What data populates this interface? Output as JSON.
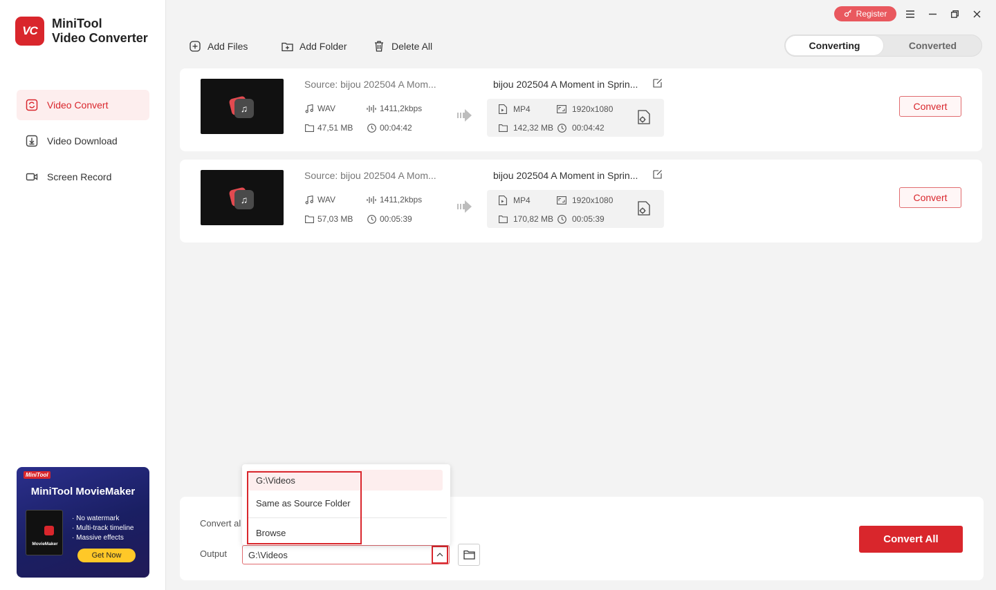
{
  "app": {
    "logo_badge": "VC",
    "name_line1": "MiniTool",
    "name_line2": "Video Converter",
    "accent_color": "#d9262c"
  },
  "sidebar": {
    "items": [
      {
        "label": "Video Convert",
        "icon": "convert-icon",
        "active": true
      },
      {
        "label": "Video Download",
        "icon": "download-icon",
        "active": false
      },
      {
        "label": "Screen Record",
        "icon": "camera-icon",
        "active": false
      }
    ],
    "ad": {
      "brand": "MiniTool",
      "title": "MiniTool MovieMaker",
      "box_label": "MovieMaker",
      "features": [
        "· No watermark",
        "· Multi-track timeline",
        "· Massive effects"
      ],
      "button": "Get Now"
    }
  },
  "titlebar": {
    "register": "Register"
  },
  "toolbar": {
    "add_files": "Add Files",
    "add_folder": "Add Folder",
    "delete_all": "Delete All"
  },
  "tabs": {
    "converting": "Converting",
    "converted": "Converted"
  },
  "files": [
    {
      "source_title": "Source:  bijou 202504 A Mom...",
      "source_format": "WAV",
      "source_bitrate": "1411,2kbps",
      "source_size": "47,51 MB",
      "source_duration": "00:04:42",
      "output_title": "bijou 202504 A Moment in Sprin...",
      "output_format": "MP4",
      "output_resolution": "1920x1080",
      "output_size": "142,32 MB",
      "output_duration": "00:04:42",
      "convert_label": "Convert"
    },
    {
      "source_title": "Source:  bijou 202504 A Mom...",
      "source_format": "WAV",
      "source_bitrate": "1411,2kbps",
      "source_size": "57,03 MB",
      "source_duration": "00:05:39",
      "output_title": "bijou 202504 A Moment in Sprin...",
      "output_format": "MP4",
      "output_resolution": "1920x1080",
      "output_size": "170,82 MB",
      "output_duration": "00:05:39",
      "convert_label": "Convert"
    }
  ],
  "bottom": {
    "convert_all_to": "Convert al",
    "output_label": "Output",
    "output_value": "G:\\Videos",
    "convert_all_button": "Convert All"
  },
  "output_menu": {
    "items": [
      "G:\\Videos",
      "Same as Source Folder",
      "Browse"
    ],
    "highlighted_index": 0
  }
}
